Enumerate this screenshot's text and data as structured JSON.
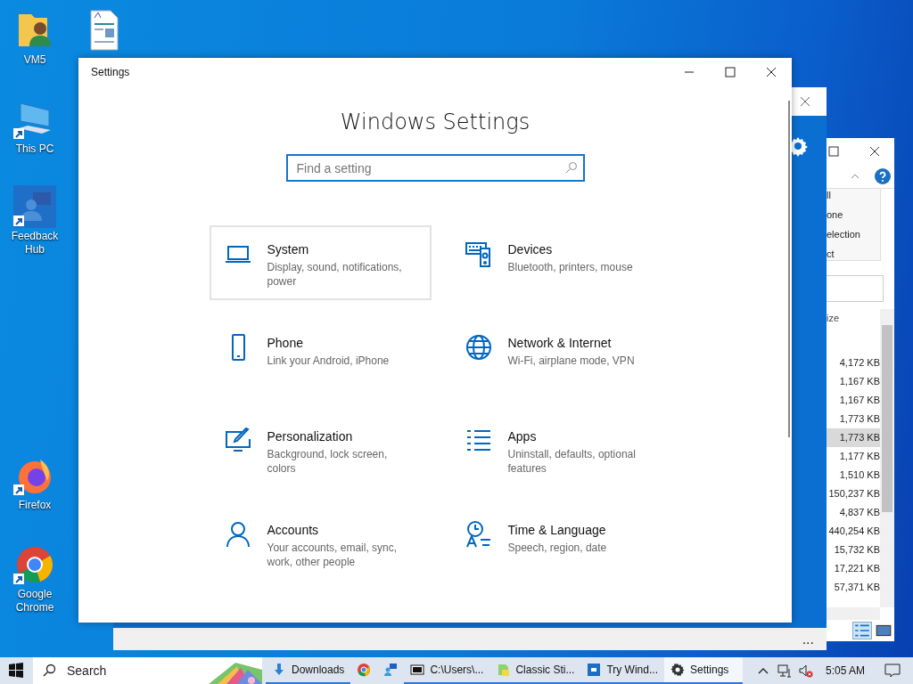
{
  "desktop_icons": [
    {
      "label": "VM5",
      "kind": "user-folder",
      "shortcut": false
    },
    {
      "kind": "document",
      "shortcut": false
    },
    {
      "label": "This PC",
      "kind": "computer",
      "shortcut": true
    },
    {
      "label": "Feedback Hub",
      "kind": "feedback",
      "shortcut": true
    },
    {
      "label": "Firefox",
      "kind": "firefox",
      "shortcut": true
    },
    {
      "label": "Google Chrome",
      "kind": "chrome",
      "shortcut": true
    }
  ],
  "file_explorer": {
    "ribbon_items": [
      "ll",
      "one",
      "election",
      "ct"
    ],
    "column_header": "ize",
    "rows": [
      {
        "size": "4,172 KB",
        "selected": false
      },
      {
        "size": "1,167 KB",
        "selected": false
      },
      {
        "size": "1,167 KB",
        "selected": false
      },
      {
        "size": "1,773 KB",
        "selected": false
      },
      {
        "size": "1,773 KB",
        "selected": true
      },
      {
        "size": "1,177 KB",
        "selected": false
      },
      {
        "size": "1,510 KB",
        "selected": false
      },
      {
        "size": "150,237 KB",
        "selected": false
      },
      {
        "size": "4,837 KB",
        "selected": false
      },
      {
        "size": "440,254 KB",
        "selected": false
      },
      {
        "size": "15,732 KB",
        "selected": false
      },
      {
        "size": "17,221 KB",
        "selected": false
      },
      {
        "size": "57,371 KB",
        "selected": false
      }
    ]
  },
  "back_window": {
    "status": "..."
  },
  "settings_window": {
    "title": "Settings",
    "heading": "Windows Settings",
    "search": {
      "placeholder": "Find a setting"
    },
    "categories": [
      {
        "kind": "system",
        "title": "System",
        "description": "Display, sound, notifications, power",
        "hovered": true
      },
      {
        "kind": "devices",
        "title": "Devices",
        "description": "Bluetooth, printers, mouse",
        "hovered": false
      },
      {
        "kind": "phone",
        "title": "Phone",
        "description": "Link your Android, iPhone",
        "hovered": false
      },
      {
        "kind": "network",
        "title": "Network & Internet",
        "description": "Wi-Fi, airplane mode, VPN",
        "hovered": false
      },
      {
        "kind": "personalization",
        "title": "Personalization",
        "description": "Background, lock screen, colors",
        "hovered": false
      },
      {
        "kind": "apps",
        "title": "Apps",
        "description": "Uninstall, defaults, optional features",
        "hovered": false
      },
      {
        "kind": "accounts",
        "title": "Accounts",
        "description": "Your accounts, email, sync, work, other people",
        "hovered": false
      },
      {
        "kind": "time",
        "title": "Time & Language",
        "description": "Speech, region, date",
        "hovered": false
      }
    ]
  },
  "taskbar": {
    "search": {
      "placeholder": "Search"
    },
    "items": [
      {
        "kind": "downloads",
        "label": "Downloads",
        "running": true,
        "selected": false
      },
      {
        "kind": "chrome",
        "running": false,
        "selected": false
      },
      {
        "kind": "chat",
        "running": false,
        "selected": false
      },
      {
        "kind": "archive",
        "label": "C:\\Users\\...",
        "running": true,
        "selected": false
      },
      {
        "kind": "sticky",
        "label": "Classic Sti...",
        "running": true,
        "selected": false
      },
      {
        "kind": "try",
        "label": "Try Wind...",
        "running": true,
        "selected": false
      },
      {
        "kind": "settings",
        "label": "Settings",
        "running": true,
        "selected": true
      }
    ],
    "time": "5:05 AM"
  }
}
